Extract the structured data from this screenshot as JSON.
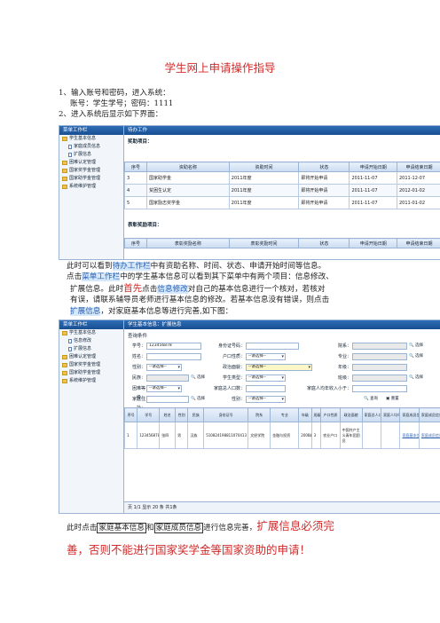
{
  "title": "学生网上申请操作指导",
  "steps": {
    "s1": "1、输入账号和密码，进入系统：",
    "s1_detail": "账号：学生学号；密码：1111",
    "s2": "2、进入系统后显示如下界面："
  },
  "shot1": {
    "sidebar_title": "菜单工作栏",
    "sidebar_items": [
      "学生基本信息",
      "家庭成员信息",
      "扩展信息",
      "困难认定管理",
      "国家奖学金管理",
      "国家助学金管理",
      "系统维护管理"
    ],
    "tab_title": "待办工作",
    "section1": "奖助项目：",
    "section2": "表彰奖励项目：",
    "columns": [
      "序号",
      "资助名称",
      "资助时间",
      "状态",
      "申请开始日期",
      "申请结束日期"
    ],
    "rows": [
      [
        "3",
        "国家助学金",
        "2011年度",
        "即将开始申请",
        "2011-11-07",
        "2011-12-07"
      ],
      [
        "4",
        "贫困生认定",
        "2011年度",
        "即将开始申请",
        "2011-11-07",
        "2012-01-02"
      ],
      [
        "5",
        "国家励志奖学金",
        "2011年度",
        "即将开始申请",
        "2011-11-07",
        "2011-01-02"
      ]
    ],
    "columns2": [
      "序号",
      "表彰奖励名称",
      "表彰奖励时间",
      "状态",
      "申请开始日期",
      "申请结束日期"
    ]
  },
  "para1": {
    "a1": "此时可以看到",
    "a_hl": "待办工作栏",
    "a2": "中有资助名称、时间、状态、申请开始时间等信息。",
    "b1": "点击",
    "b_hl": "菜单工作栏",
    "b2": "中的学生基本信息可以看到其下菜单中有两个项目：信息修改、",
    "c1": "扩展信息。此时",
    "c_big": "首先",
    "c2": "点击",
    "c_hl": "信息修改",
    "c3": "对自己的基本信息进行一个核对，若核对",
    "d1": "有误，请联系辅导员老师进行基本信息的修改。若基本信息没有错误，则点击",
    "e_hl": "扩展信息",
    "e2": "，对家庭基本信息等进行完善,如下图："
  },
  "shot2": {
    "sidebar_title": "菜单工作栏",
    "sidebar_items": [
      "学生基本信息",
      "信息修改",
      "扩展信息",
      "困难认定管理",
      "国家奖学金管理",
      "国家助学金管理",
      "系统维护管理"
    ],
    "tab_title": "学生基本信息：扩展信息",
    "query_label": "查询条件",
    "fields": {
      "xuehao": "学号：",
      "xuehao_val": "123456878",
      "shenfen": "身份证号码：",
      "yuanxi": "院系：",
      "xingming": "姓名：",
      "hukou": "户口性质：",
      "hukou_val": "--请选择--",
      "zhuanye": "专业：",
      "xingbie": "性别：",
      "xingbie_val": "--请选择--",
      "zhengzhi": "政治面貌：",
      "zhengzhi_val": "--请选择--",
      "nianji": "年级：",
      "minzu": "民族：",
      "xuesheng": "学生类型：",
      "xuesheng_val": "--请选择--",
      "banji": "班级：",
      "kunnan": "困难等级：",
      "kunnan_val": "--请选择--",
      "jiating": "家庭总人口数：",
      "renjun": "家庭人均年收入小于：",
      "dizhi": "家庭住址：",
      "xingbie2": "性别：",
      "xingbie2_val": "--请选择--",
      "select_btn": "选择",
      "query_btn": "查询",
      "reset_btn": "重置"
    },
    "columns": [
      "序号",
      "学号",
      "姓名",
      "性别",
      "民族",
      "身份证号",
      "院系",
      "专业",
      "年级",
      "班级",
      "户口性质",
      "政治面貌",
      "家庭总人口数",
      "家庭人均年收入",
      "家庭成员信息",
      "家庭成员信息"
    ],
    "row": [
      "1",
      "123456878",
      "张四",
      "男",
      "汉族",
      "510824198811070413",
      "文经学院",
      "金融与投资",
      "2008级",
      "3",
      "农业户口",
      "中国共产主义青年团团员",
      "",
      "",
      "家庭基本信息",
      "家庭成员信息"
    ],
    "pager": "页 1/1     显示 20 条 共1条"
  },
  "para2": {
    "a1": "此时点击",
    "box1": "家庭基本信息",
    "a2": "和",
    "box2": "家庭成员信息",
    "a3": "进行信息完善，",
    "a_red": "扩展信息必须完",
    "b_red": "善，否则不能进行国家奖学金等国家资助的申请！"
  }
}
